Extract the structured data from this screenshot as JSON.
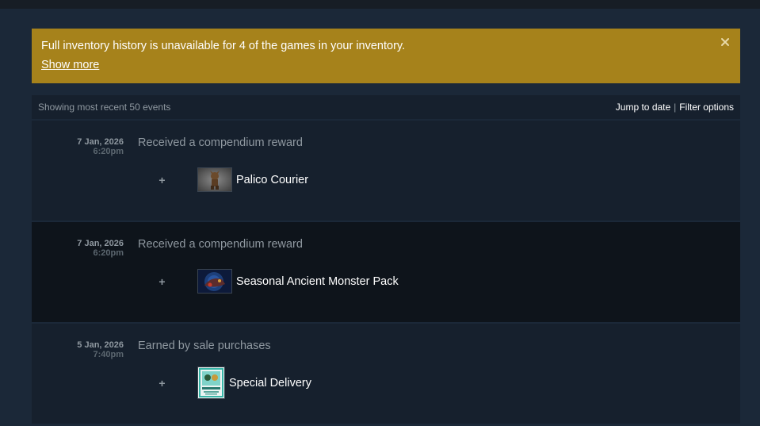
{
  "notice": {
    "text": "Full inventory history is unavailable for 4 of the games in your inventory.",
    "link": "Show more",
    "close_icon": "close-icon"
  },
  "history": {
    "summary": "Showing most recent 50 events",
    "jump_label": "Jump to date",
    "separator": "|",
    "filter_label": "Filter options",
    "events": [
      {
        "date": "7 Jan, 2026",
        "time": "6:20pm",
        "description": "Received a compendium reward",
        "plus": "+",
        "item": "Palico Courier"
      },
      {
        "date": "7 Jan, 2026",
        "time": "6:20pm",
        "description": "Received a compendium reward",
        "plus": "+",
        "item": "Seasonal Ancient Monster Pack"
      },
      {
        "date": "5 Jan, 2026",
        "time": "7:40pm",
        "description": "Earned by sale purchases",
        "plus": "+",
        "item": "Special Delivery"
      }
    ]
  },
  "colors": {
    "page_bg": "#1b2838",
    "notice_bg": "#a6821b",
    "row_bg": "#16202d",
    "row_alt_bg": "#0e141b",
    "muted_text": "#8f98a0"
  }
}
